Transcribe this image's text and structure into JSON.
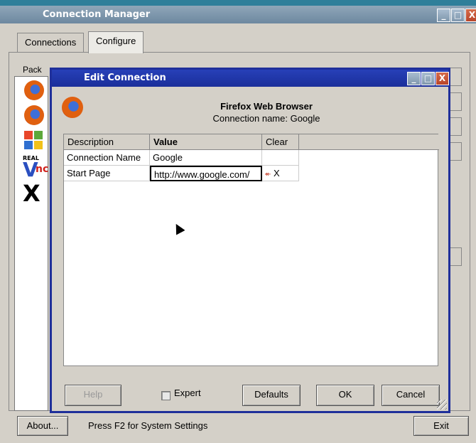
{
  "outer_window": {
    "title": "Connection Manager",
    "minimize_glyph": "_",
    "maximize_glyph": "□",
    "close_glyph": "X",
    "tabs": [
      {
        "label": "Connections"
      },
      {
        "label": "Configure"
      }
    ],
    "package_list_header": "Pack",
    "package_icons": [
      "firefox-icon",
      "firefox-icon",
      "windows-icon",
      "realvnc-icon",
      "x-icon"
    ],
    "realvnc_text": "REAL",
    "vnc_v": "V",
    "vnc_nc": "nc",
    "x_glyph": "X"
  },
  "status_bar": {
    "about_label": "About...",
    "hint": "Press F2 for System Settings",
    "exit_label": "Exit"
  },
  "dialog": {
    "title": "Edit Connection",
    "app_name": "Firefox Web Browser",
    "connection_name_line": "Connection name: Google",
    "columns": [
      "Description",
      "Value",
      "Clear"
    ],
    "rows": [
      {
        "description": "Connection Name",
        "value": "Google",
        "clear": ""
      },
      {
        "description": "Start Page",
        "value": "http://www.google.com/",
        "clear": "X"
      }
    ],
    "buttons": {
      "help": "Help",
      "expert": "Expert",
      "defaults": "Defaults",
      "ok": "OK",
      "cancel": "Cancel"
    }
  }
}
